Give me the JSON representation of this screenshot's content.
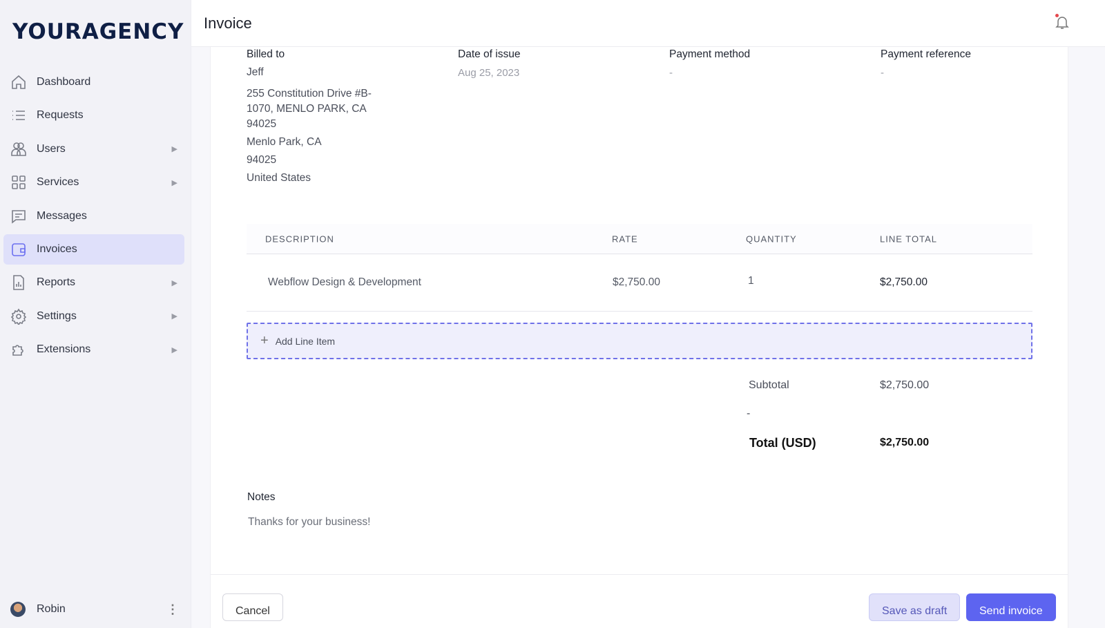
{
  "logo": "YOURAGENCY",
  "sidebar": {
    "items": [
      {
        "label": "Dashboard",
        "icon": "home-icon"
      },
      {
        "label": "Requests",
        "icon": "list-icon"
      },
      {
        "label": "Users",
        "icon": "users-icon",
        "arrow": "▶"
      },
      {
        "label": "Services",
        "icon": "grid-icon",
        "arrow": "▶"
      },
      {
        "label": "Messages",
        "icon": "message-icon"
      },
      {
        "label": "Invoices",
        "icon": "wallet-icon",
        "active": true
      },
      {
        "label": "Reports",
        "icon": "report-icon",
        "arrow": "▶"
      },
      {
        "label": "Settings",
        "icon": "gear-icon",
        "arrow": "▶"
      },
      {
        "label": "Extensions",
        "icon": "puzzle-icon",
        "arrow": "▶"
      }
    ],
    "user": {
      "name": "Robin",
      "menu": "⋮"
    }
  },
  "header": {
    "title": "Invoice"
  },
  "invoice": {
    "billed_to": {
      "label": "Billed to",
      "name": "Jeff",
      "address": [
        "255 Constitution Drive #B-",
        "1070, MENLO PARK, CA",
        "94025"
      ],
      "city": "Menlo Park, CA",
      "zip": "94025",
      "country": "United States"
    },
    "date": {
      "label": "Date of issue",
      "value": "Aug 25, 2023"
    },
    "payment_method": {
      "label": "Payment method",
      "value": "-"
    },
    "payment_reference": {
      "label": "Payment reference",
      "value": "-"
    },
    "columns": [
      "DESCRIPTION",
      "RATE",
      "QUANTITY",
      "LINE TOTAL"
    ],
    "rows": [
      {
        "description": "Webflow Design & Development",
        "rate": "$2,750.00",
        "quantity": "1",
        "total": "$2,750.00"
      }
    ],
    "add_line": "Add Line Item",
    "subtotal_label": "Subtotal",
    "subtotal": "$2,750.00",
    "tax": "-",
    "total_label": "Total (USD)",
    "total": "$2,750.00",
    "notes_label": "Notes",
    "notes": "Thanks for your business!"
  },
  "actions": {
    "cancel": "Cancel",
    "draft": "Save as draft",
    "send": "Send invoice"
  },
  "colors": {
    "accent": "#5d64f0",
    "active_bg": "#dfe0fa"
  }
}
